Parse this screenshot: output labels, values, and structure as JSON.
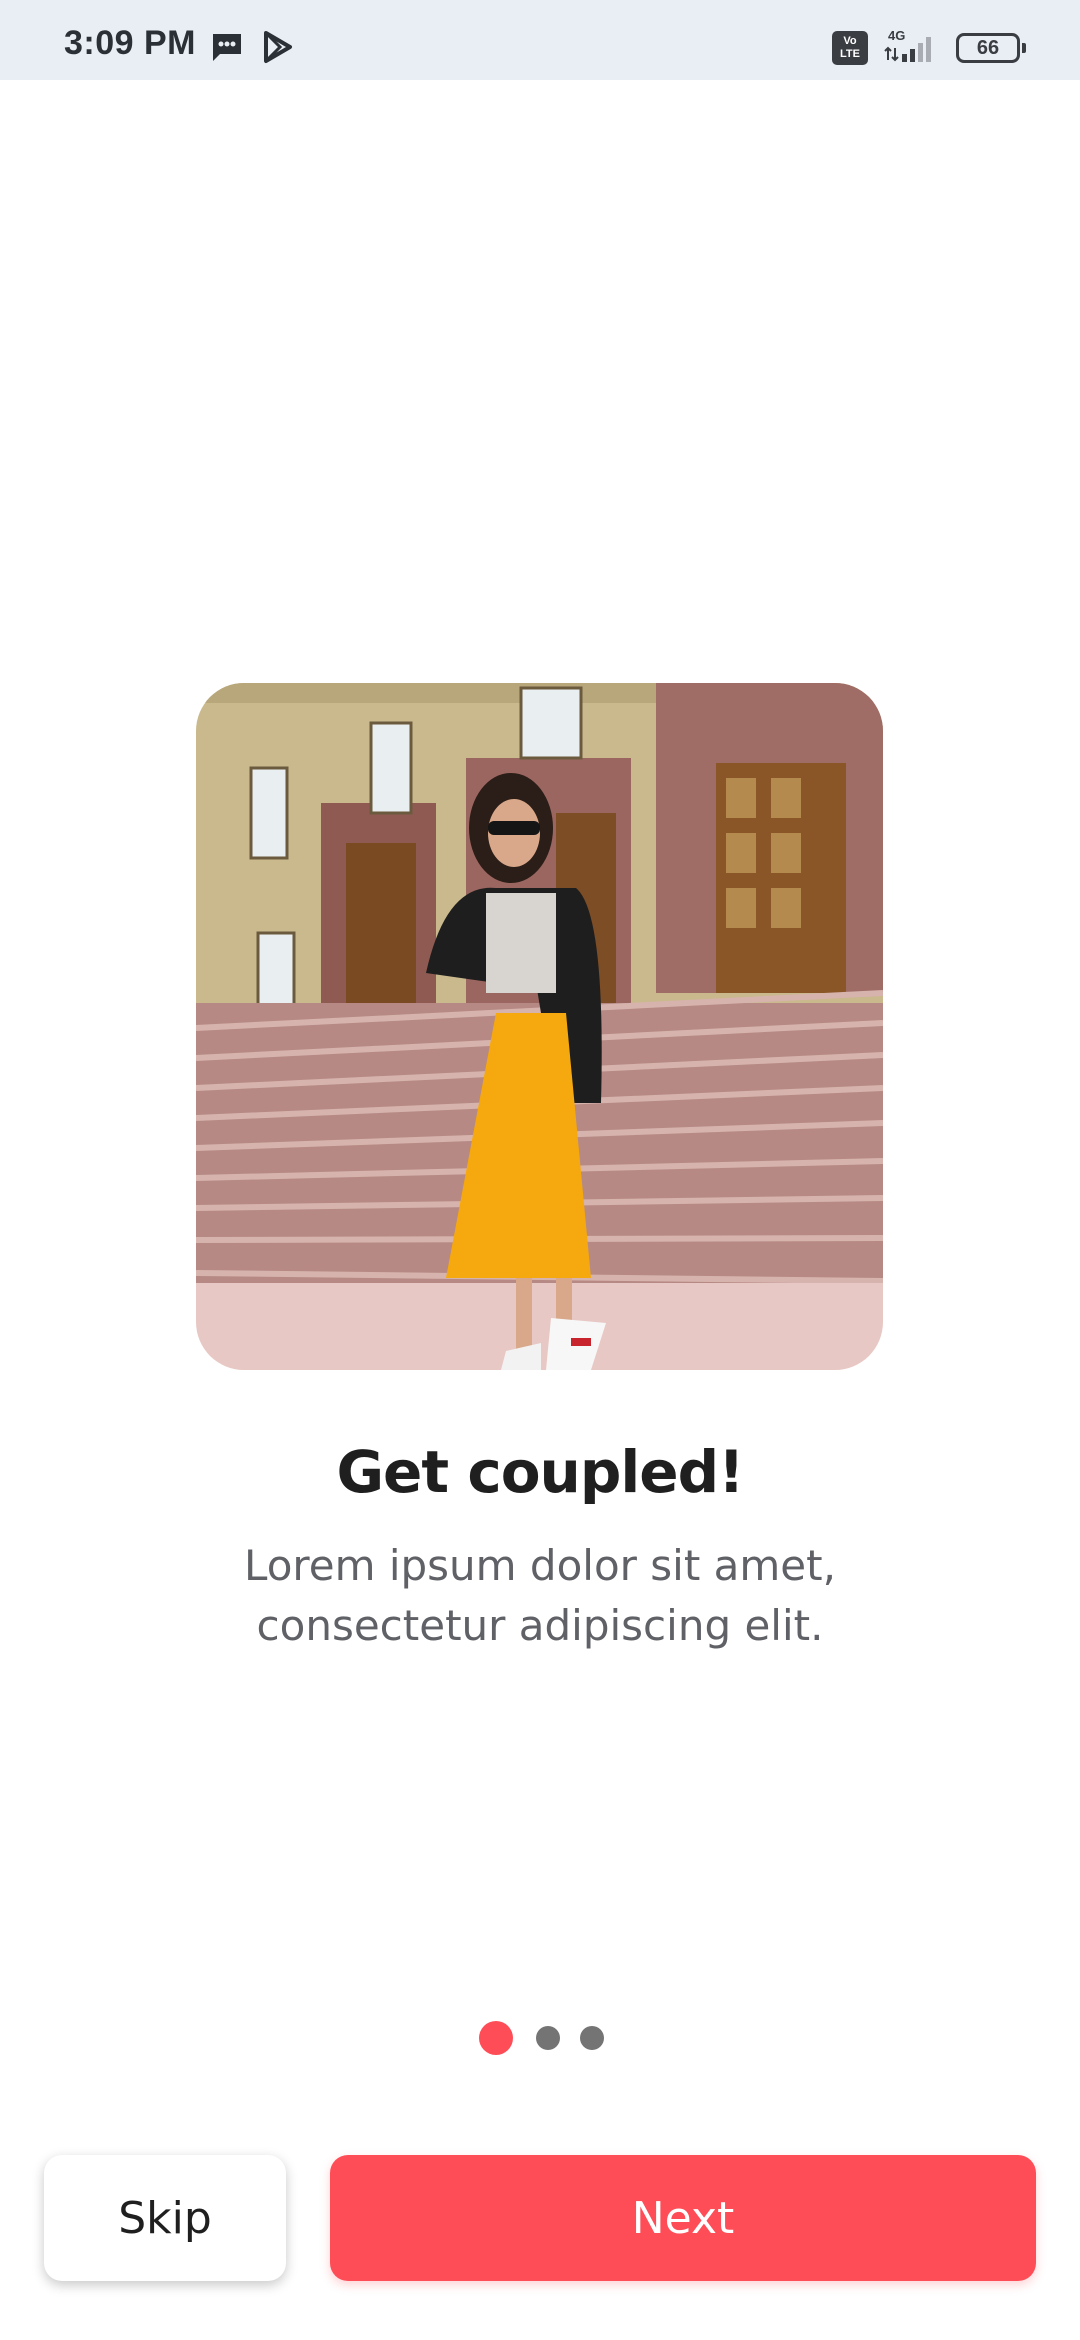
{
  "status_bar": {
    "time": "3:09 PM",
    "left_icons": [
      "message-icon",
      "play-store-icon"
    ],
    "volte_label": "Vo LTE",
    "network_label": "4G",
    "battery_level": "66"
  },
  "onboarding": {
    "image_description_name": "fashion-photo",
    "title": "Get coupled!",
    "subtitle": "Lorem ipsum dolor sit amet, consectetur adipiscing elit.",
    "page_count": 3,
    "active_page": 1
  },
  "buttons": {
    "skip_label": "Skip",
    "next_label": "Next"
  },
  "colors": {
    "accent": "#ff4d57",
    "status_bar_bg": "#e9eef5",
    "inactive_dot": "#747474"
  }
}
